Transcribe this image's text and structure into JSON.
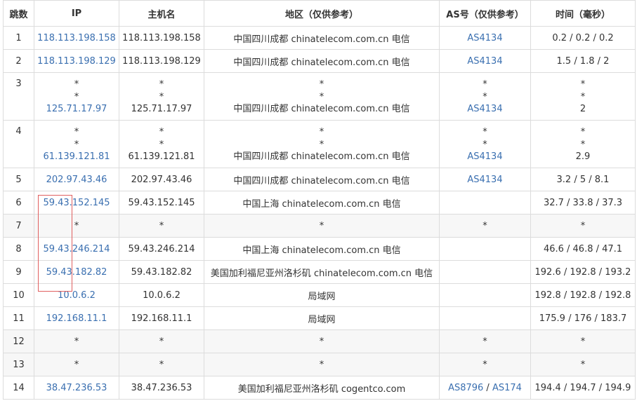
{
  "header": {
    "hop": "跳数",
    "ip": "IP",
    "host": "主机名",
    "region": "地区（仅供参考）",
    "as": "AS号（仅供参考）",
    "time": "时间（毫秒）"
  },
  "rows": [
    {
      "hop": "1",
      "ip": "118.113.198.158",
      "host": "118.113.198.158",
      "region": "中国四川成都 chinatelecom.com.cn 电信",
      "as": "AS4134",
      "time": "0.2 / 0.2 / 0.2"
    },
    {
      "hop": "2",
      "ip": "118.113.198.129",
      "host": "118.113.198.129",
      "region": "中国四川成都 chinatelecom.com.cn 电信",
      "as": "AS4134",
      "time": "1.5 / 1.8 / 2"
    },
    {
      "hop": "3",
      "ip": [
        "*",
        "*",
        "125.71.17.97"
      ],
      "host": [
        "*",
        "*",
        "125.71.17.97"
      ],
      "region": [
        "*",
        "*",
        "中国四川成都 chinatelecom.com.cn 电信"
      ],
      "as": [
        "*",
        "*",
        "AS4134"
      ],
      "time": [
        "*",
        "*",
        "2"
      ]
    },
    {
      "hop": "4",
      "ip": [
        "*",
        "*",
        "61.139.121.81"
      ],
      "host": [
        "*",
        "*",
        "61.139.121.81"
      ],
      "region": [
        "*",
        "*",
        "中国四川成都 chinatelecom.com.cn 电信"
      ],
      "as": [
        "*",
        "*",
        "AS4134"
      ],
      "time": [
        "*",
        "*",
        "2.9"
      ]
    },
    {
      "hop": "5",
      "ip": "202.97.43.46",
      "host": "202.97.43.46",
      "region": "中国四川成都 chinatelecom.com.cn 电信",
      "as": "AS4134",
      "time": "3.2 / 5 / 8.1"
    },
    {
      "hop": "6",
      "ip": "59.43.152.145",
      "host": "59.43.152.145",
      "region": "中国上海 chinatelecom.com.cn 电信",
      "as": "",
      "time": "32.7 / 33.8 / 37.3"
    },
    {
      "hop": "7",
      "ip": "*",
      "host": "*",
      "region": "*",
      "as": "*",
      "time": "*"
    },
    {
      "hop": "8",
      "ip": "59.43.246.214",
      "host": "59.43.246.214",
      "region": "中国上海 chinatelecom.com.cn 电信",
      "as": "",
      "time": "46.6 / 46.8 / 47.1"
    },
    {
      "hop": "9",
      "ip": "59.43.182.82",
      "host": "59.43.182.82",
      "region": "美国加利福尼亚州洛杉矶 chinatelecom.com.cn 电信",
      "as": "",
      "time": "192.6 / 192.8 / 193.2"
    },
    {
      "hop": "10",
      "ip": "10.0.6.2",
      "host": "10.0.6.2",
      "region": "局域网",
      "as": "",
      "time": "192.8 / 192.8 / 192.8"
    },
    {
      "hop": "11",
      "ip": "192.168.11.1",
      "host": "192.168.11.1",
      "region": "局域网",
      "as": "",
      "time": "175.9 / 176 / 183.7"
    },
    {
      "hop": "12",
      "ip": "*",
      "host": "*",
      "region": "*",
      "as": "*",
      "time": "*"
    },
    {
      "hop": "13",
      "ip": "*",
      "host": "*",
      "region": "*",
      "as": "*",
      "time": "*"
    },
    {
      "hop": "14",
      "ip": "38.47.236.53",
      "host": "38.47.236.53",
      "region": "美国加利福尼亚州洛杉矶 cogentco.com",
      "as": "AS8796 / AS174",
      "as_parts": [
        "AS8796",
        "AS174"
      ],
      "time": "194.4 / 194.7 / 194.9"
    }
  ],
  "colors": {
    "link": "#3a6fb0",
    "zebra": "#f7f7f7",
    "border": "#dcdcdc",
    "highlight_box": "#e06060"
  }
}
